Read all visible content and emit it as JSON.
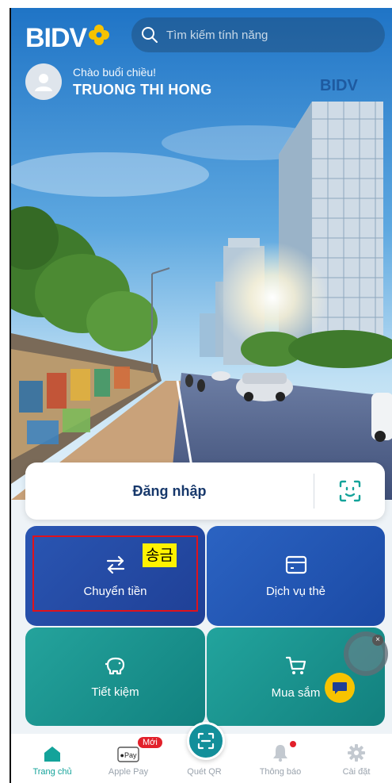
{
  "header": {
    "logo_text": "BIDV",
    "search_placeholder": "Tìm kiếm tính năng",
    "greeting": "Chào buổi chiều!",
    "user_name": "TRUONG THI HONG",
    "building_sign": "BIDV"
  },
  "login": {
    "label": "Đăng nhập"
  },
  "tiles": [
    {
      "label": "Chuyển tiền",
      "icon": "transfer-arrows-icon"
    },
    {
      "label": "Dịch vụ thẻ",
      "icon": "card-icon"
    },
    {
      "label": "Tiết kiệm",
      "icon": "piggy-bank-icon"
    },
    {
      "label": "Mua sắm",
      "icon": "shopping-cart-icon"
    }
  ],
  "annotation": {
    "highlight_text": "송금",
    "box_color": "#e0121b",
    "label_bg": "#fff200"
  },
  "nav": {
    "items": [
      {
        "label": "Trang chủ",
        "icon": "home-icon",
        "active": true
      },
      {
        "label": "Apple Pay",
        "icon": "apple-pay-icon",
        "badge": "Mới"
      },
      {
        "label": "Quét QR",
        "icon": "qr-scan-icon"
      },
      {
        "label": "Thông báo",
        "icon": "bell-icon"
      },
      {
        "label": "Cài đặt",
        "icon": "gear-icon"
      }
    ]
  },
  "colors": {
    "brand_teal": "#14a39a",
    "brand_blue": "#1f3f95",
    "logo_yellow": "#f7c300"
  }
}
